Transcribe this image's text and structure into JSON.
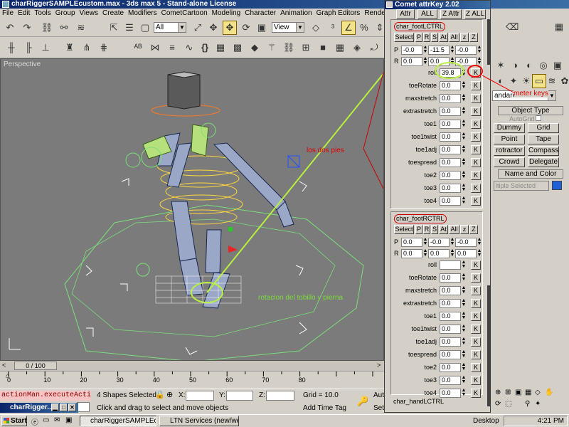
{
  "window": {
    "title": "charRiggerSAMPLEcustom.max - 3ds max 5 - Stand-alone License"
  },
  "menu": [
    "File",
    "Edit",
    "Tools",
    "Group",
    "Views",
    "Create",
    "Modifiers",
    "CometCartoon",
    "Modeling",
    "Character",
    "Animation",
    "Graph Editors",
    "Rendering",
    "Customize",
    "MAXScript"
  ],
  "toolbar": {
    "selection_filter": "All",
    "ref_coord": "View"
  },
  "viewport": {
    "label": "Perspective"
  },
  "timeline": {
    "frame_display": "0 / 100",
    "ticks": [
      "0",
      "10",
      "20",
      "30",
      "40",
      "50",
      "60",
      "70",
      "80"
    ]
  },
  "status": {
    "listener": "actionMan.executeAction 0",
    "selected": "4 Shapes Selected",
    "x_label": "X:",
    "y_label": "Y:",
    "z_label": "Z:",
    "grid": "Grid = 10.0",
    "prompt": "Click and drag to select and move objects",
    "add_time_tag": "Add Time Tag",
    "auto_key_partial": "Auto",
    "set_key_partial": "Set"
  },
  "minimized_window": {
    "title": "charRigger..."
  },
  "taskbar": {
    "start": "Start",
    "items": [
      "charRiggerSAMPLEcu...",
      "LTN Services (new/web...."
    ],
    "desktop": "Desktop",
    "clock": "4:21 PM"
  },
  "attrkey": {
    "title": "Comet attrKey 2.02",
    "tabs": [
      "Attr",
      "ALL",
      "Z Attr",
      "Z ALL"
    ],
    "group1": {
      "name": "char_footLCTRL",
      "buttons": [
        "Select",
        "P",
        "R",
        "S",
        "At",
        "All",
        "z",
        "Z"
      ],
      "p_label": "P",
      "r_label": "R",
      "p_values": [
        "-0.0",
        "-11.5",
        "-0.0"
      ],
      "r_values": [
        "0.0",
        "0.0",
        "-0.0"
      ],
      "params": [
        {
          "name": "roll",
          "value": "39.8"
        },
        {
          "name": "toeRotate",
          "value": "0.0"
        },
        {
          "name": "maxstretch",
          "value": "0.0"
        },
        {
          "name": "extrastretch",
          "value": "0.0"
        },
        {
          "name": "toe1",
          "value": "0.0"
        },
        {
          "name": "toe1twist",
          "value": "0.0"
        },
        {
          "name": "toe1adj",
          "value": "0.0"
        },
        {
          "name": "toespread",
          "value": "0.0"
        },
        {
          "name": "toe2",
          "value": "0.0"
        },
        {
          "name": "toe3",
          "value": "0.0"
        },
        {
          "name": "toe4",
          "value": "0.0"
        }
      ]
    },
    "group2": {
      "name": "char_footRCTRL",
      "buttons": [
        "Select",
        "P",
        "R",
        "S",
        "At",
        "All",
        "z",
        "Z"
      ],
      "p_label": "P",
      "r_label": "R",
      "p_values": [
        "0.0",
        "-0.0",
        "-0.0"
      ],
      "r_values": [
        "0.0",
        "0.0",
        "0.0"
      ],
      "params": [
        {
          "name": "roll",
          "value": ""
        },
        {
          "name": "toeRotate",
          "value": "0.0"
        },
        {
          "name": "maxstretch",
          "value": "0.0"
        },
        {
          "name": "extrastretch",
          "value": "0.0"
        },
        {
          "name": "toe1",
          "value": "0.0"
        },
        {
          "name": "toe1twist",
          "value": "0.0"
        },
        {
          "name": "toe1adj",
          "value": "0.0"
        },
        {
          "name": "toespread",
          "value": "0.0"
        },
        {
          "name": "toe2",
          "value": "0.0"
        },
        {
          "name": "toe3",
          "value": "0.0"
        },
        {
          "name": "toe4",
          "value": "0.0"
        }
      ]
    },
    "group3": {
      "name": "char_handLCTRL"
    },
    "k_label": "K"
  },
  "command_panel": {
    "dropdown": "andard",
    "object_type": "Object Type",
    "autogrid": "AutoGrid",
    "buttons": [
      "Dummy",
      "Grid",
      "Point",
      "Tape",
      "rotractor",
      "Compass",
      "Crowd",
      "Delegate"
    ],
    "name_color": "Name and Color",
    "name_field": "ltiple Selected",
    "swatch_color": "#1f5fd8"
  },
  "annotations": {
    "meter_keys": "meter keys",
    "los_dos_pies": "los dos pies",
    "rotacion": "rotacion del tobillo y pierna"
  }
}
